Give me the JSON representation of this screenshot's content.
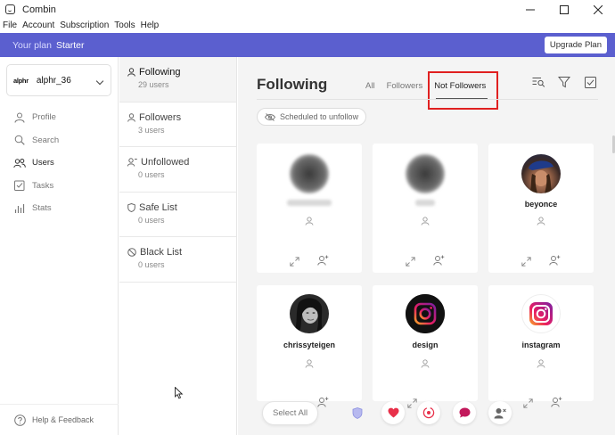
{
  "window": {
    "title": "Combin",
    "controls": [
      "minimize-icon",
      "maximize-icon",
      "close-icon"
    ]
  },
  "menu": [
    "File",
    "Account",
    "Subscription",
    "Tools",
    "Help"
  ],
  "plan": {
    "label": "Your plan",
    "name": "Starter",
    "upgrade": "Upgrade Plan",
    "color": "#5b5fcf"
  },
  "account": {
    "avatar": "alphr",
    "username": "alphr_36"
  },
  "nav": [
    {
      "label": "Profile",
      "icon": "person-icon"
    },
    {
      "label": "Search",
      "icon": "search-icon"
    },
    {
      "label": "Users",
      "icon": "users-icon"
    },
    {
      "label": "Tasks",
      "icon": "tasks-icon"
    },
    {
      "label": "Stats",
      "icon": "stats-icon"
    }
  ],
  "help": "Help & Feedback",
  "lists": [
    {
      "title": "Following",
      "count": "29 users",
      "icon": "user-icon"
    },
    {
      "title": "Followers",
      "count": "3 users",
      "icon": "user-icon"
    },
    {
      "title": "Unfollowed",
      "count": "0 users",
      "icon": "user-minus-icon"
    },
    {
      "title": "Safe List",
      "count": "0 users",
      "icon": "shield-icon"
    },
    {
      "title": "Black List",
      "count": "0 users",
      "icon": "blocked-icon"
    }
  ],
  "main": {
    "title": "Following",
    "tabs": [
      "All",
      "Followers",
      "Not Followers"
    ],
    "active_tab": "Not Followers",
    "chip": "Scheduled to unfollow",
    "select_all": "Select All"
  },
  "cards": [
    {
      "name": "",
      "blurred": true
    },
    {
      "name": "",
      "blurred": true
    },
    {
      "name": "beyonce",
      "blurred": false
    },
    {
      "name": "chrissyteigen",
      "blurred": false
    },
    {
      "name": "design",
      "blurred": false
    },
    {
      "name": "instagram",
      "blurred": false
    }
  ],
  "colors": {
    "highlight": "#e02020",
    "accent": "#5b5fcf",
    "heart": "#e8304a",
    "bubble": "#c2185b"
  }
}
